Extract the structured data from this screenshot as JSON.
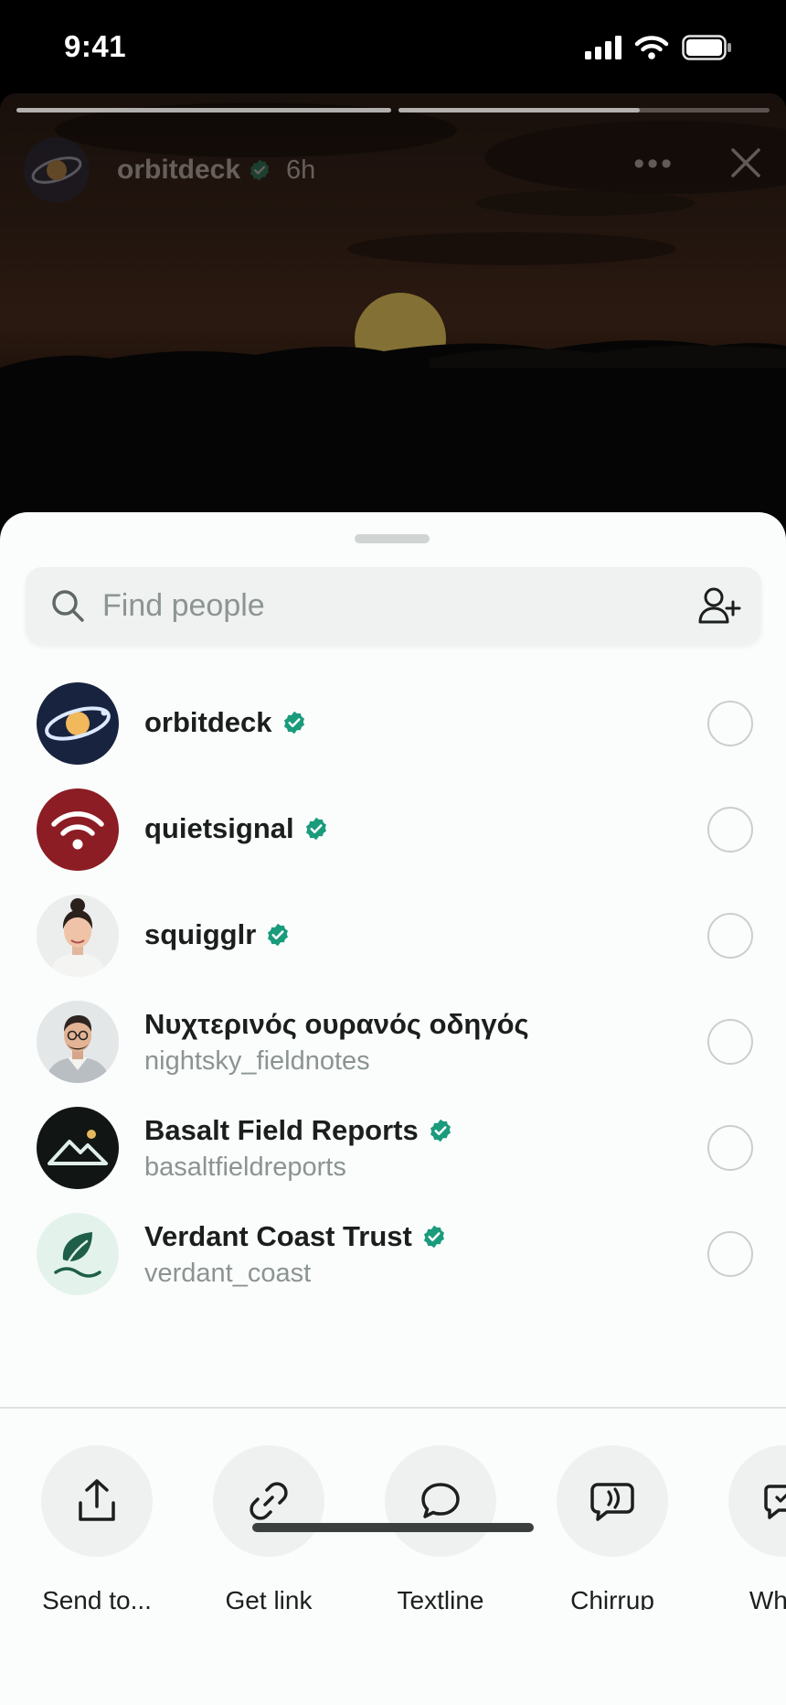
{
  "status_bar": {
    "time": "9:41"
  },
  "story": {
    "account": "orbitdeck",
    "age": "6h",
    "more_icon": "ellipsis-icon",
    "close_icon": "close-icon",
    "progress": [
      1.0,
      0.65
    ]
  },
  "search": {
    "placeholder": "Find people",
    "value": ""
  },
  "people": [
    {
      "name": "orbitdeck",
      "username": "",
      "verified": true,
      "avatar": "orbit-logo"
    },
    {
      "name": "quietsignal",
      "username": "",
      "verified": true,
      "avatar": "wifi-logo"
    },
    {
      "name": "squigglr",
      "username": "",
      "verified": true,
      "avatar": "portrait-woman"
    },
    {
      "name": "Νυχτερινός ουρανός οδηγός",
      "username": "nightsky_fieldnotes",
      "verified": false,
      "avatar": "portrait-man"
    },
    {
      "name": "Basalt Field Reports",
      "username": "basaltfieldreports",
      "verified": true,
      "avatar": "mountain-logo"
    },
    {
      "name": "Verdant Coast Trust",
      "username": "verdant_coast",
      "verified": true,
      "avatar": "leaf-logo"
    }
  ],
  "actions": [
    {
      "label": "Send to...",
      "icon": "share-icon"
    },
    {
      "label": "Get link",
      "icon": "link-icon"
    },
    {
      "label": "Textline",
      "icon": "chat-bubble-icon"
    },
    {
      "label": "Chirrup",
      "icon": "chirrup-icon"
    },
    {
      "label": "Whistl",
      "icon": "whistl-icon"
    }
  ],
  "colors": {
    "verified": "#1a9b7c",
    "sheet": "#fbfdfc",
    "orbit_bg": "#18233f",
    "signal_red": "#8c1d24",
    "basalt_bg": "#111514"
  }
}
